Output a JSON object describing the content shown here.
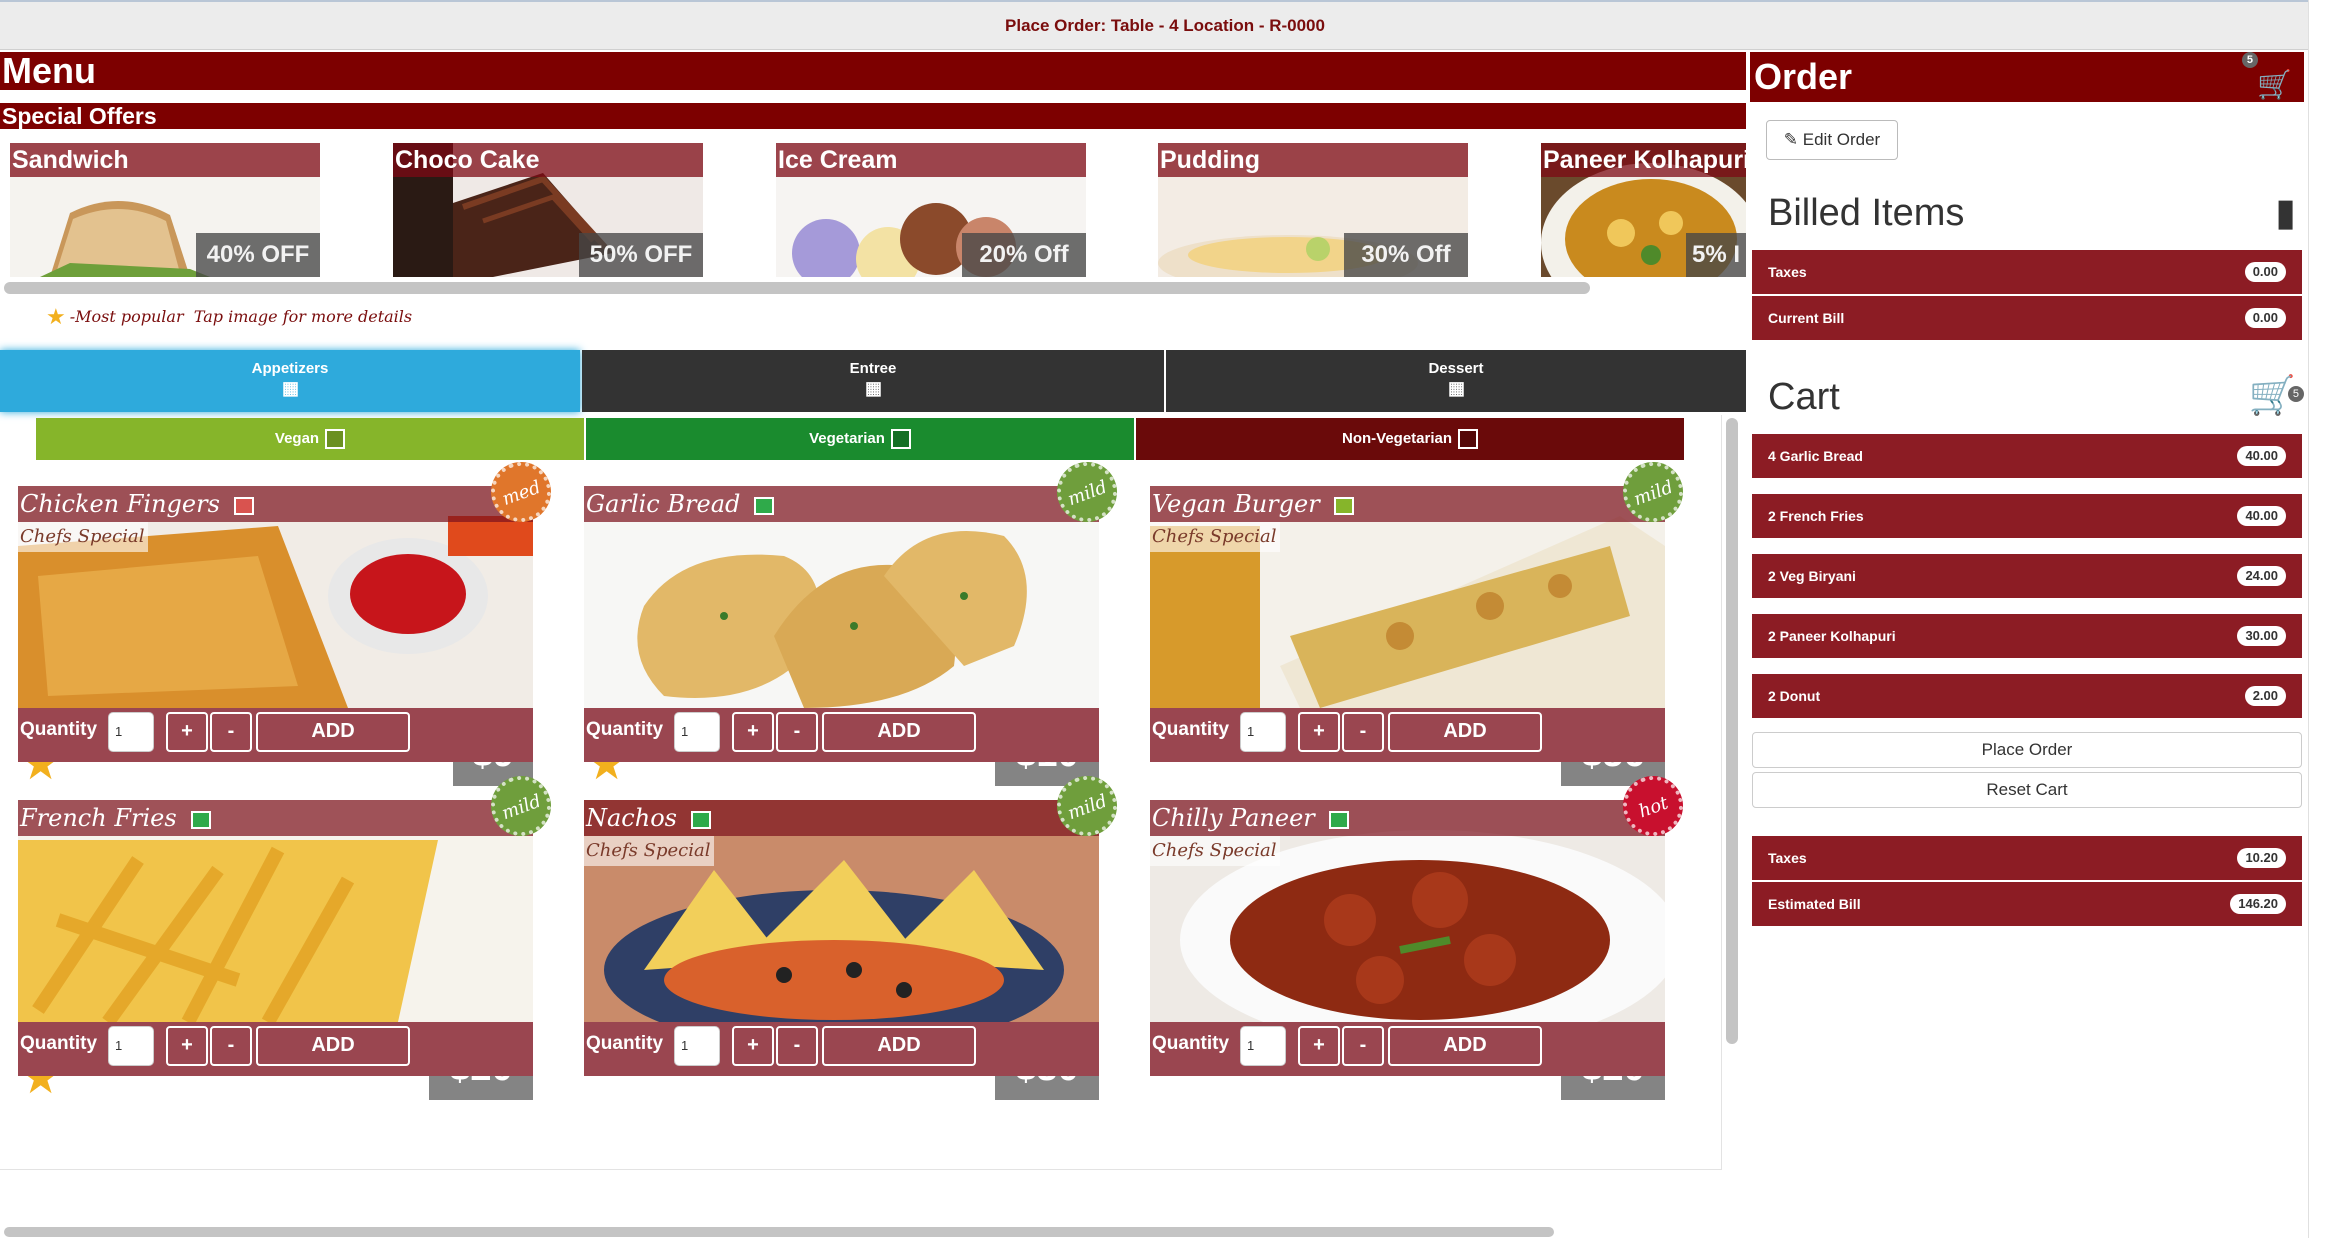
{
  "page_title": "Place Order: Table - 4 Location - R-0000",
  "menu": {
    "title": "Menu",
    "special_offers_title": "Special Offers",
    "offers": [
      {
        "name": "Sandwich",
        "discount": "40% OFF"
      },
      {
        "name": "Choco Cake",
        "discount": "50% OFF"
      },
      {
        "name": "Ice Cream",
        "discount": "20% Off"
      },
      {
        "name": "Pudding",
        "discount": "30% Off"
      },
      {
        "name": "Paneer Kolhapuri",
        "discount": "5% I"
      }
    ],
    "legend": {
      "most_popular": "-Most popular",
      "tap_hint": "Tap image for more details",
      "star_icon": "star-icon"
    },
    "tabs": [
      {
        "label": "Appetizers",
        "active": true
      },
      {
        "label": "Entree",
        "active": false
      },
      {
        "label": "Dessert",
        "active": false
      }
    ],
    "filters": [
      {
        "label": "Vegan",
        "color": "#86b52a"
      },
      {
        "label": "Vegetarian",
        "color": "#1a8b2e"
      },
      {
        "label": "Non-Vegetarian",
        "color": "#6a0a0a"
      }
    ],
    "quantity_label": "Quantity",
    "add_label": "ADD",
    "plus_label": "+",
    "minus_label": "-",
    "items": [
      {
        "name": "Chicken Fingers",
        "chef_special": "Chefs Special",
        "price": "$9",
        "spice": "med",
        "popular": true,
        "quantity": "1"
      },
      {
        "name": "Garlic Bread",
        "chef_special": "",
        "price": "$10",
        "spice": "mild",
        "popular": true,
        "quantity": "1"
      },
      {
        "name": "Vegan Burger",
        "chef_special": "Chefs Special",
        "price": "$56",
        "spice": "mild",
        "popular": false,
        "quantity": "1"
      },
      {
        "name": "French Fries",
        "chef_special": "",
        "price": "$20",
        "spice": "mild",
        "popular": true,
        "quantity": "1"
      },
      {
        "name": "Nachos",
        "chef_special": "Chefs Special",
        "price": "$30",
        "spice": "mild",
        "popular": false,
        "quantity": "1"
      },
      {
        "name": "Chilly Paneer",
        "chef_special": "Chefs Special",
        "price": "$20",
        "spice": "hot",
        "popular": false,
        "quantity": "1"
      }
    ]
  },
  "order": {
    "title": "Order",
    "cart_count": "5",
    "edit_order_label": "Edit Order",
    "billed_items_title": "Billed Items",
    "billed_rows": [
      {
        "label": "Taxes",
        "value": "0.00"
      },
      {
        "label": "Current Bill",
        "value": "0.00"
      }
    ],
    "cart_title": "Cart",
    "cart_rows": [
      {
        "label": "4 Garlic Bread",
        "value": "40.00"
      },
      {
        "label": "2 French Fries",
        "value": "40.00"
      },
      {
        "label": "2 Veg Biryani",
        "value": "24.00"
      },
      {
        "label": "2 Paneer Kolhapuri",
        "value": "30.00"
      },
      {
        "label": "2 Donut",
        "value": "2.00"
      }
    ],
    "place_order_label": "Place Order",
    "reset_cart_label": "Reset Cart",
    "summary_rows": [
      {
        "label": "Taxes",
        "value": "10.20"
      },
      {
        "label": "Estimated Bill",
        "value": "146.20"
      }
    ]
  },
  "colors": {
    "brand": "#7d0000",
    "active_tab": "#2eaadc",
    "inactive_tab": "#333333",
    "spice_med": "#e0762b",
    "spice_mild": "#6f9e3c",
    "spice_hot": "#c8102e"
  }
}
